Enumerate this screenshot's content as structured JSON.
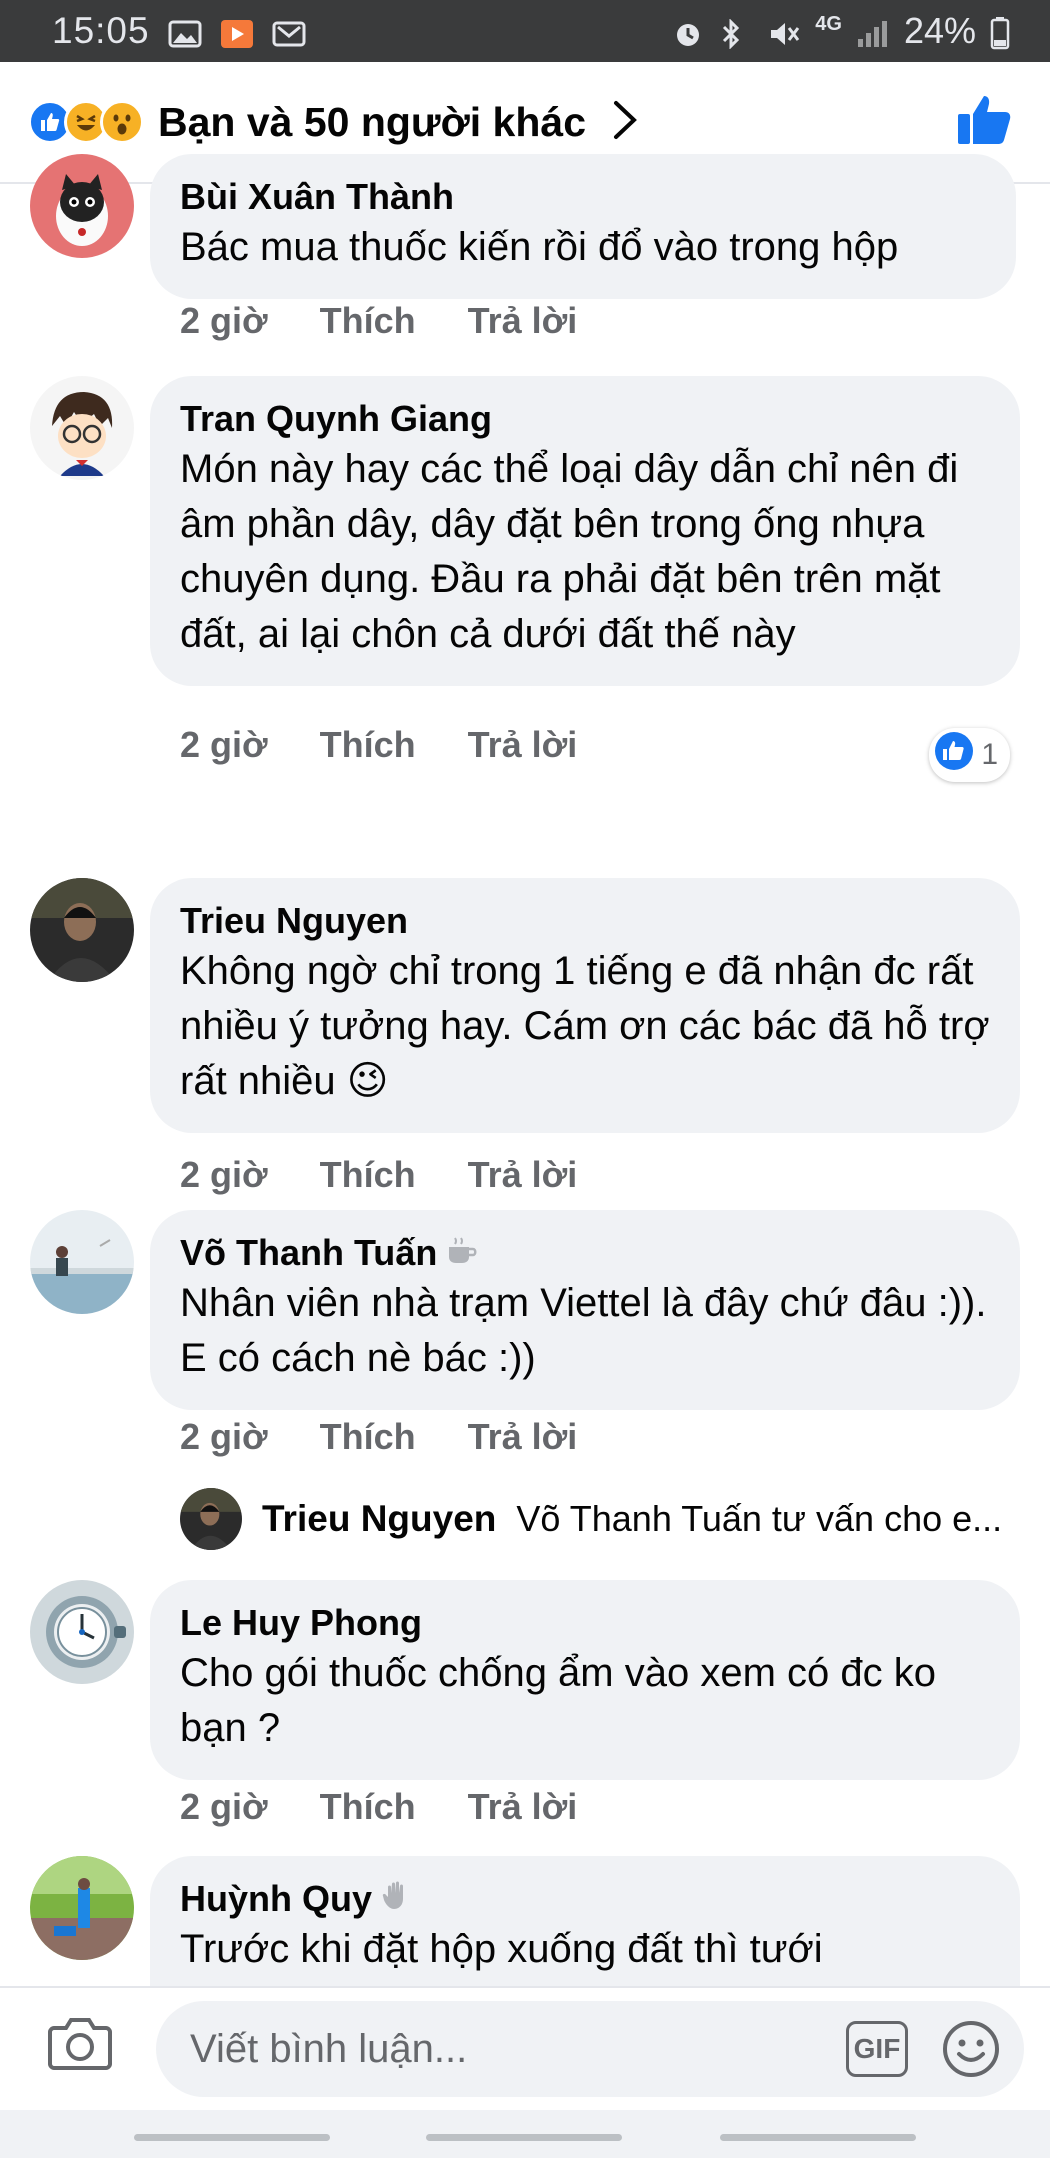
{
  "status_bar": {
    "time": "15:05",
    "network": "4G",
    "battery": "24%",
    "icons": [
      "image-icon",
      "youtube-icon",
      "mail-icon",
      "alarm-icon",
      "bluetooth-icon",
      "mute-icon",
      "signal-icon",
      "battery-icon"
    ]
  },
  "header": {
    "reactions_text": "Bạn và 50 người khác",
    "reaction_icons": [
      "like-icon",
      "haha-icon",
      "wow-icon"
    ]
  },
  "comments": [
    {
      "author": "Bùi Xuân Thành",
      "text": "Bác mua thuốc kiến rồi đổ vào trong hộp",
      "time": "2 giờ",
      "like": "Thích",
      "reply": "Trả lời"
    },
    {
      "author": "Tran Quynh Giang",
      "text": "Món này hay các thể loại dây dẫn chỉ nên đi âm phần dây, dây đặt bên trong ống nhựa chuyên dụng. Đầu ra phải đặt bên trên mặt đất, ai lại chôn cả dưới đất thế này",
      "time": "2 giờ",
      "like": "Thích",
      "reply": "Trả lời",
      "reaction_count": "1"
    },
    {
      "author": "Trieu Nguyen",
      "text": "Không ngờ chỉ trong 1 tiếng e đã nhận đc rất nhiều ý tưởng hay. Cám ơn các bác đã hỗ trợ rất nhiều",
      "emoji": "😉",
      "time": "2 giờ",
      "like": "Thích",
      "reply": "Trả lời"
    },
    {
      "author": "Võ Thanh Tuấn",
      "text": "Nhân viên nhà trạm Viettel là đây chứ đâu :)). E có cách nè bác :))",
      "time": "2 giờ",
      "like": "Thích",
      "reply": "Trả lời"
    },
    {
      "author": "Le Huy Phong",
      "text": "Cho gói thuốc chống ẩm vào xem có đc ko bạn ?",
      "time": "2 giờ",
      "like": "Thích",
      "reply": "Trả lời"
    },
    {
      "author": "Huỳnh Quy",
      "text": "Trước khi đặt hộp xuống đất thì tưới"
    }
  ],
  "reply_preview": {
    "author": "Trieu Nguyen",
    "text": "Võ Thanh Tuấn tư vấn cho e..."
  },
  "composer": {
    "placeholder": "Viết bình luận...",
    "gif_label": "GIF"
  },
  "colors": {
    "accent": "#1877f2",
    "bubble": "#f0f2f5",
    "meta_text": "#65676b",
    "status_bar": "#3a3b3c"
  }
}
